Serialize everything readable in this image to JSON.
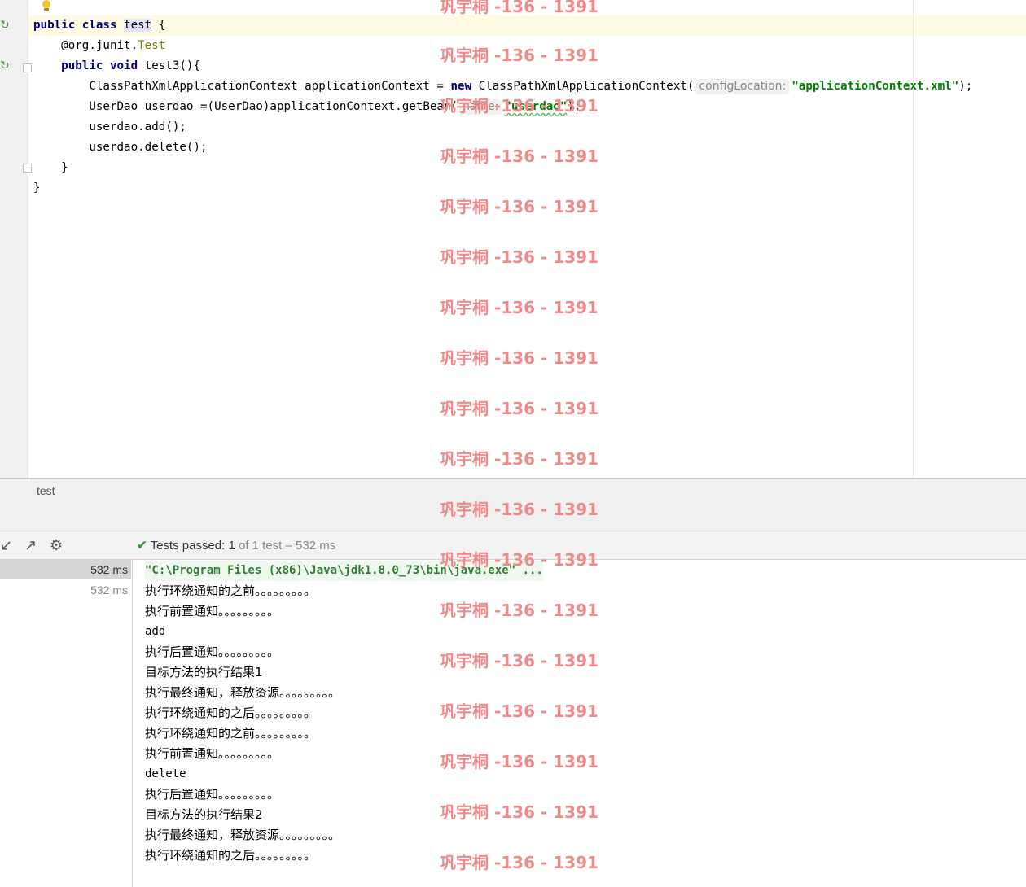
{
  "editor": {
    "lines": [
      {
        "kw1": "public",
        "kw2": "class",
        "name": "test",
        "rest": " {"
      },
      {
        "annotation": "@org.junit.",
        "annotation_class": "Test"
      },
      {
        "kw1": "public",
        "kw2": "void",
        "rest": " test3(){"
      },
      {
        "pre": "ClassPathXmlApplicationContext applicationContext = ",
        "kw": "new",
        "post": " ClassPathXmlApplicationContext(",
        "hint": "configLocation:",
        "str": "\"applicationContext.xml\"",
        "end": ");"
      },
      {
        "pre": "UserDao userdao =(UserDao)applicationContext.getBean(",
        "hint": "name:",
        "str": "\"userdao\"",
        "end": ");"
      },
      {
        "text": "userdao.add();"
      },
      {
        "text": "userdao.delete();"
      },
      {
        "text": "}"
      },
      {
        "text": "}"
      }
    ]
  },
  "tabbar": {
    "tab_label": "test"
  },
  "toolbar": {
    "status_label": "Tests passed:",
    "passed_count": "1",
    "of_text": "of 1 test – 532 ms",
    "icons": [
      "collapse-icon",
      "export-icon",
      "settings-icon"
    ]
  },
  "tree": {
    "rows": [
      {
        "time": "532 ms",
        "selected": true
      },
      {
        "time": "532 ms",
        "selected": false
      }
    ]
  },
  "console": {
    "lines": [
      "\"C:\\Program Files (x86)\\Java\\jdk1.8.0_73\\bin\\java.exe\" ...",
      "执行环绕通知的之前。。。。。。。。。",
      "执行前置通知。。。。。。。。。",
      "add",
      "执行后置通知。。。。。。。。。",
      "目标方法的执行结果1",
      "执行最终通知，释放资源。。。。。。。。。",
      "执行环绕通知的之后。。。。。。。。。",
      "执行环绕通知的之前。。。。。。。。。",
      "执行前置通知。。。。。。。。。",
      "delete",
      "执行后置通知。。。。。。。。。",
      "目标方法的执行结果2",
      "执行最终通知，释放资源。。。。。。。。。",
      "执行环绕通知的之后。。。。。。。。。"
    ]
  },
  "watermark": {
    "text": "巩宇桐 -136 - 1391"
  },
  "colors": {
    "keyword": "#000080",
    "string": "#008000",
    "annotation": "#808000",
    "watermark": "#f08a8a",
    "pass": "#3b9a3b"
  }
}
